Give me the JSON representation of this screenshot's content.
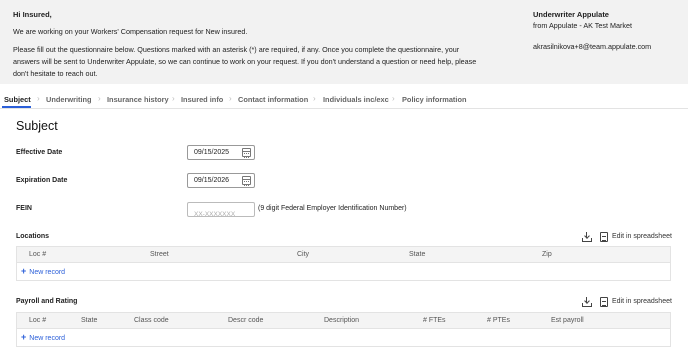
{
  "header": {
    "greeting": "Hi Insured,",
    "message1": "We are working on your Workers' Compensation request for New insured.",
    "message2": "Please fill out the questionnaire below. Questions marked with an asterisk (*) are required, if any. Once you complete the questionnaire, your answers will be sent to Underwriter Appulate, so we can continue to work on your request. If you don't understand a question or need help, please don't hesitate to reach out.",
    "underwriter_title": "Underwriter Appulate",
    "underwriter_from": "from Appulate - AK Test Market",
    "underwriter_email": "akrasilnikova+8@team.appulate.com"
  },
  "tabs": [
    {
      "label": "Subject",
      "active": true
    },
    {
      "label": "Underwriting"
    },
    {
      "label": "Insurance history"
    },
    {
      "label": "Insured info"
    },
    {
      "label": "Contact information"
    },
    {
      "label": "Individuals inc/exc"
    },
    {
      "label": "Policy information"
    }
  ],
  "section_title": "Subject",
  "fields": {
    "effective_date": {
      "label": "Effective Date",
      "value": "09/15/2025"
    },
    "expiration_date": {
      "label": "Expiration Date",
      "value": "09/15/2026"
    },
    "fein": {
      "label": "FEIN",
      "placeholder": "XX-XXXXXXX",
      "help": "(9 digit Federal Employer Identification Number)"
    }
  },
  "locations": {
    "title": "Locations",
    "edit_label": "Edit in spreadsheet",
    "columns": [
      "Loc #",
      "Street",
      "City",
      "State",
      "Zip"
    ],
    "new_record": "New record"
  },
  "payroll": {
    "title": "Payroll and Rating",
    "edit_label": "Edit in spreadsheet",
    "columns": [
      "Loc #",
      "State",
      "Class code",
      "Descr code",
      "Description",
      "# FTEs",
      "# PTEs",
      "Est payroll"
    ],
    "new_record": "New record"
  },
  "icons": [
    "calendar-icon",
    "download-icon",
    "document-icon",
    "plus-icon",
    "chevron-right-icon"
  ],
  "colors": {
    "accent": "#2b5fd9",
    "banner_bg": "#f2f2f2"
  }
}
